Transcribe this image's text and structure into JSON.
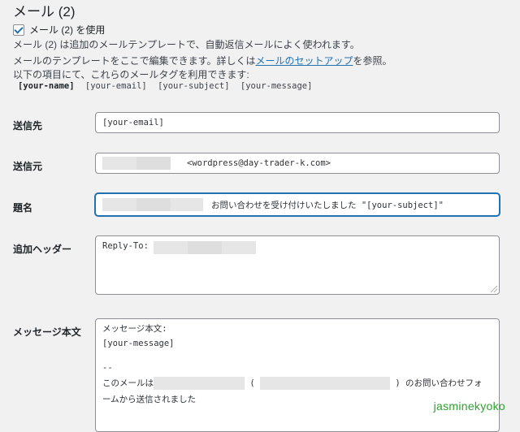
{
  "section": {
    "title": "メール (2)",
    "checkbox_label": "メール (2) を使用",
    "desc1": "メール (2) は追加のメールテンプレートで、自動返信メールによく使われます。",
    "desc2_pre": "メールのテンプレートをここで編集できます。詳しくは",
    "desc2_link": "メールのセットアップ",
    "desc2_post": "を参照。",
    "desc3": "以下の項目にて、これらのメールタグを利用できます:",
    "tags": [
      "[your-name]",
      "[your-email]",
      "[your-subject]",
      "[your-message]"
    ]
  },
  "fields": {
    "to": {
      "label": "送信先",
      "value": "[your-email]"
    },
    "from": {
      "label": "送信元",
      "value": "<wordpress@day-trader-k.com>"
    },
    "subject": {
      "label": "題名",
      "value": "お問い合わせを受け付けいたしました \"[your-subject]\""
    },
    "headers": {
      "label": "追加ヘッダー",
      "value": "Reply-To:"
    },
    "body": {
      "label": "メッセージ本文",
      "line1": "メッセージ本文:",
      "line2": "[your-message]",
      "line3": "--",
      "line4_pre": "このメールは",
      "line4_mid": "(",
      "line4_post": ") のお問い合わせフォ",
      "line5": "ームから送信されました"
    }
  },
  "caption": "jasminekyoko",
  "colors": {
    "accent": "#2271b1",
    "caption": "#2fa12f"
  }
}
